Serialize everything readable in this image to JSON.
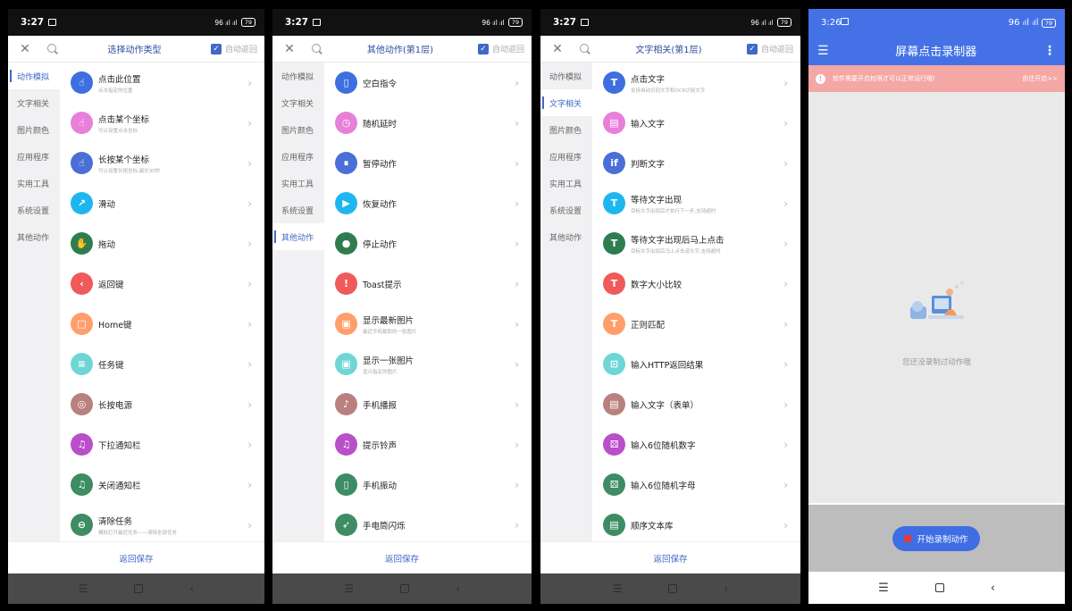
{
  "panels": [
    {
      "time": "3:27",
      "title": "选择动作类型",
      "auto_return": "自动返回",
      "categories": [
        "动作模拟",
        "文字相关",
        "图片颜色",
        "应用程序",
        "实用工具",
        "系统设置",
        "其他动作"
      ],
      "active_category": 0,
      "items": [
        {
          "title": "点击此位置",
          "sub": "点击指定的位置",
          "color": "#3d6fe0",
          "icon": "tap-icon"
        },
        {
          "title": "点击某个坐标",
          "sub": "可以设置点击坐标",
          "color": "#e87fd9",
          "icon": "tap-icon"
        },
        {
          "title": "长按某个坐标",
          "sub": "可以设置长按坐标,最长30秒",
          "color": "#4a6fd6",
          "icon": "tap-icon"
        },
        {
          "title": "滑动",
          "sub": "",
          "color": "#1eb6ef",
          "icon": "swipe-icon"
        },
        {
          "title": "拖动",
          "sub": "",
          "color": "#2e7d4f",
          "icon": "drag-icon"
        },
        {
          "title": "返回键",
          "sub": "",
          "color": "#ef5a5a",
          "icon": "back-icon"
        },
        {
          "title": "Home键",
          "sub": "",
          "color": "#ff9e6b",
          "icon": "home-icon"
        },
        {
          "title": "任务键",
          "sub": "",
          "color": "#6fd6d6",
          "icon": "menu-icon"
        },
        {
          "title": "长按电源",
          "sub": "",
          "color": "#b8807e",
          "icon": "power-icon"
        },
        {
          "title": "下拉通知栏",
          "sub": "",
          "color": "#b94fc9",
          "icon": "bell-icon"
        },
        {
          "title": "关闭通知栏",
          "sub": "",
          "color": "#3d8c64",
          "icon": "bell-icon"
        },
        {
          "title": "清除任务",
          "sub": "模拟打开最近任务——清除全部任务",
          "color": "#3d8c64",
          "icon": "clear-icon"
        }
      ],
      "save": "返回保存"
    },
    {
      "time": "3:27",
      "title": "其他动作(第1层)",
      "auto_return": "自动返回",
      "categories": [
        "动作模拟",
        "文字相关",
        "图片颜色",
        "应用程序",
        "实用工具",
        "系统设置",
        "其他动作"
      ],
      "active_category": 6,
      "items": [
        {
          "title": "空白指令",
          "sub": "",
          "color": "#3d6fe0",
          "icon": "doc-icon"
        },
        {
          "title": "随机延时",
          "sub": "",
          "color": "#e87fd9",
          "icon": "clock-icon"
        },
        {
          "title": "暂停动作",
          "sub": "",
          "color": "#4a6fd6",
          "icon": "pause-icon"
        },
        {
          "title": "恢复动作",
          "sub": "",
          "color": "#1eb6ef",
          "icon": "play-icon"
        },
        {
          "title": "停止动作",
          "sub": "",
          "color": "#2e7d4f",
          "icon": "stop-icon"
        },
        {
          "title": "Toast提示",
          "sub": "",
          "color": "#ef5a5a",
          "icon": "alert-icon"
        },
        {
          "title": "显示最新图片",
          "sub": "最近手机截取的一张图片",
          "color": "#ff9e6b",
          "icon": "image-icon"
        },
        {
          "title": "显示一张图片",
          "sub": "显示指定的图片",
          "color": "#6fd6d6",
          "icon": "image-icon"
        },
        {
          "title": "手机播报",
          "sub": "",
          "color": "#b8807e",
          "icon": "speaker-icon"
        },
        {
          "title": "提示铃声",
          "sub": "",
          "color": "#b94fc9",
          "icon": "bell-icon"
        },
        {
          "title": "手机振动",
          "sub": "",
          "color": "#3d8c64",
          "icon": "vibrate-icon"
        },
        {
          "title": "手电筒闪烁",
          "sub": "",
          "color": "#3d8c64",
          "icon": "rocket-icon"
        }
      ],
      "save": "返回保存"
    },
    {
      "time": "3:27",
      "title": "文字相关(第1层)",
      "auto_return": "自动返回",
      "categories": [
        "动作模拟",
        "文字相关",
        "图片颜色",
        "应用程序",
        "实用工具",
        "系统设置",
        "其他动作"
      ],
      "active_category": 1,
      "items": [
        {
          "title": "点击文字",
          "sub": "支持自动识别文字和OCR识别文字",
          "color": "#3d6fe0",
          "icon": "text-icon"
        },
        {
          "title": "输入文字",
          "sub": "",
          "color": "#e87fd9",
          "icon": "input-icon"
        },
        {
          "title": "判断文字",
          "sub": "",
          "color": "#4a6fd6",
          "icon": "if-icon"
        },
        {
          "title": "等待文字出现",
          "sub": "目标文字出现后才执行下一步,支持超时",
          "color": "#1eb6ef",
          "icon": "text-icon"
        },
        {
          "title": "等待文字出现后马上点击",
          "sub": "目标文字出现后马上点击该文字,支持超时",
          "color": "#2e7d4f",
          "icon": "text-icon"
        },
        {
          "title": "数字大小比较",
          "sub": "",
          "color": "#ef5a5a",
          "icon": "text-icon"
        },
        {
          "title": "正则匹配",
          "sub": "",
          "color": "#ff9e6b",
          "icon": "text-icon"
        },
        {
          "title": "输入HTTP返回结果",
          "sub": "",
          "color": "#6fd6d6",
          "icon": "http-icon"
        },
        {
          "title": "输入文字（表单）",
          "sub": "",
          "color": "#b8807e",
          "icon": "form-icon"
        },
        {
          "title": "输入6位随机数字",
          "sub": "",
          "color": "#b94fc9",
          "icon": "dice-icon"
        },
        {
          "title": "输入6位随机字母",
          "sub": "",
          "color": "#3d8c64",
          "icon": "dice-icon"
        },
        {
          "title": "顺序文本库",
          "sub": "",
          "color": "#3d8c64",
          "icon": "library-icon"
        }
      ],
      "save": "返回保存"
    }
  ],
  "recorder": {
    "time": "3:26",
    "title": "屏幕点击录制器",
    "warning": "软件需要开启权限才可以正常运行哦!",
    "warning_link": "前往开启>>",
    "empty_text": "您还没录制过动作哦",
    "start_button": "开始录制动作"
  },
  "statusbar_right": "96 ᵢıl ᵢıl ",
  "battery": "79"
}
